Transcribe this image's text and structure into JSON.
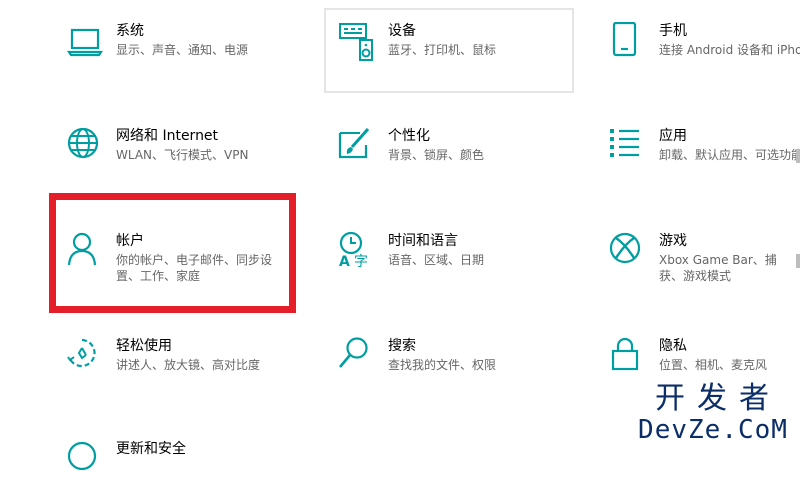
{
  "tiles": {
    "system": {
      "title": "系统",
      "desc": "显示、声音、通知、电源",
      "icon": "laptop-icon"
    },
    "devices": {
      "title": "设备",
      "desc": "蓝牙、打印机、鼠标",
      "icon": "keyboard-speaker-icon"
    },
    "phone": {
      "title": "手机",
      "desc": "连接 Android 设备和 iPhone",
      "icon": "phone-icon"
    },
    "network": {
      "title": "网络和 Internet",
      "desc": "WLAN、飞行模式、VPN",
      "icon": "globe-icon"
    },
    "personalization": {
      "title": "个性化",
      "desc": "背景、锁屏、颜色",
      "icon": "paint-brush-icon"
    },
    "apps": {
      "title": "应用",
      "desc": "卸载、默认应用、可选功能",
      "icon": "app-list-icon"
    },
    "accounts": {
      "title": "帐户",
      "desc": "你的帐户、电子邮件、同步设置、工作、家庭",
      "icon": "person-icon"
    },
    "time_language": {
      "title": "时间和语言",
      "desc": "语音、区域、日期",
      "icon": "clock-language-icon"
    },
    "gaming": {
      "title": "游戏",
      "desc": "Xbox Game Bar、捕获、游戏模式",
      "icon": "xbox-icon"
    },
    "ease_of_access": {
      "title": "轻松使用",
      "desc": "讲述人、放大镜、高对比度",
      "icon": "ease-of-access-icon"
    },
    "search": {
      "title": "搜索",
      "desc": "查找我的文件、权限",
      "icon": "search-icon"
    },
    "privacy": {
      "title": "隐私",
      "desc": "位置、相机、麦克风",
      "icon": "lock-icon"
    },
    "update": {
      "title": "更新和安全",
      "icon": "sync-icon"
    }
  },
  "watermark": {
    "line1": "开发者",
    "line2": "DevZe.CoM"
  },
  "colors": {
    "accent": "#009ea0",
    "highlight": "#e51f2a",
    "watermark": "#0b2d68"
  }
}
